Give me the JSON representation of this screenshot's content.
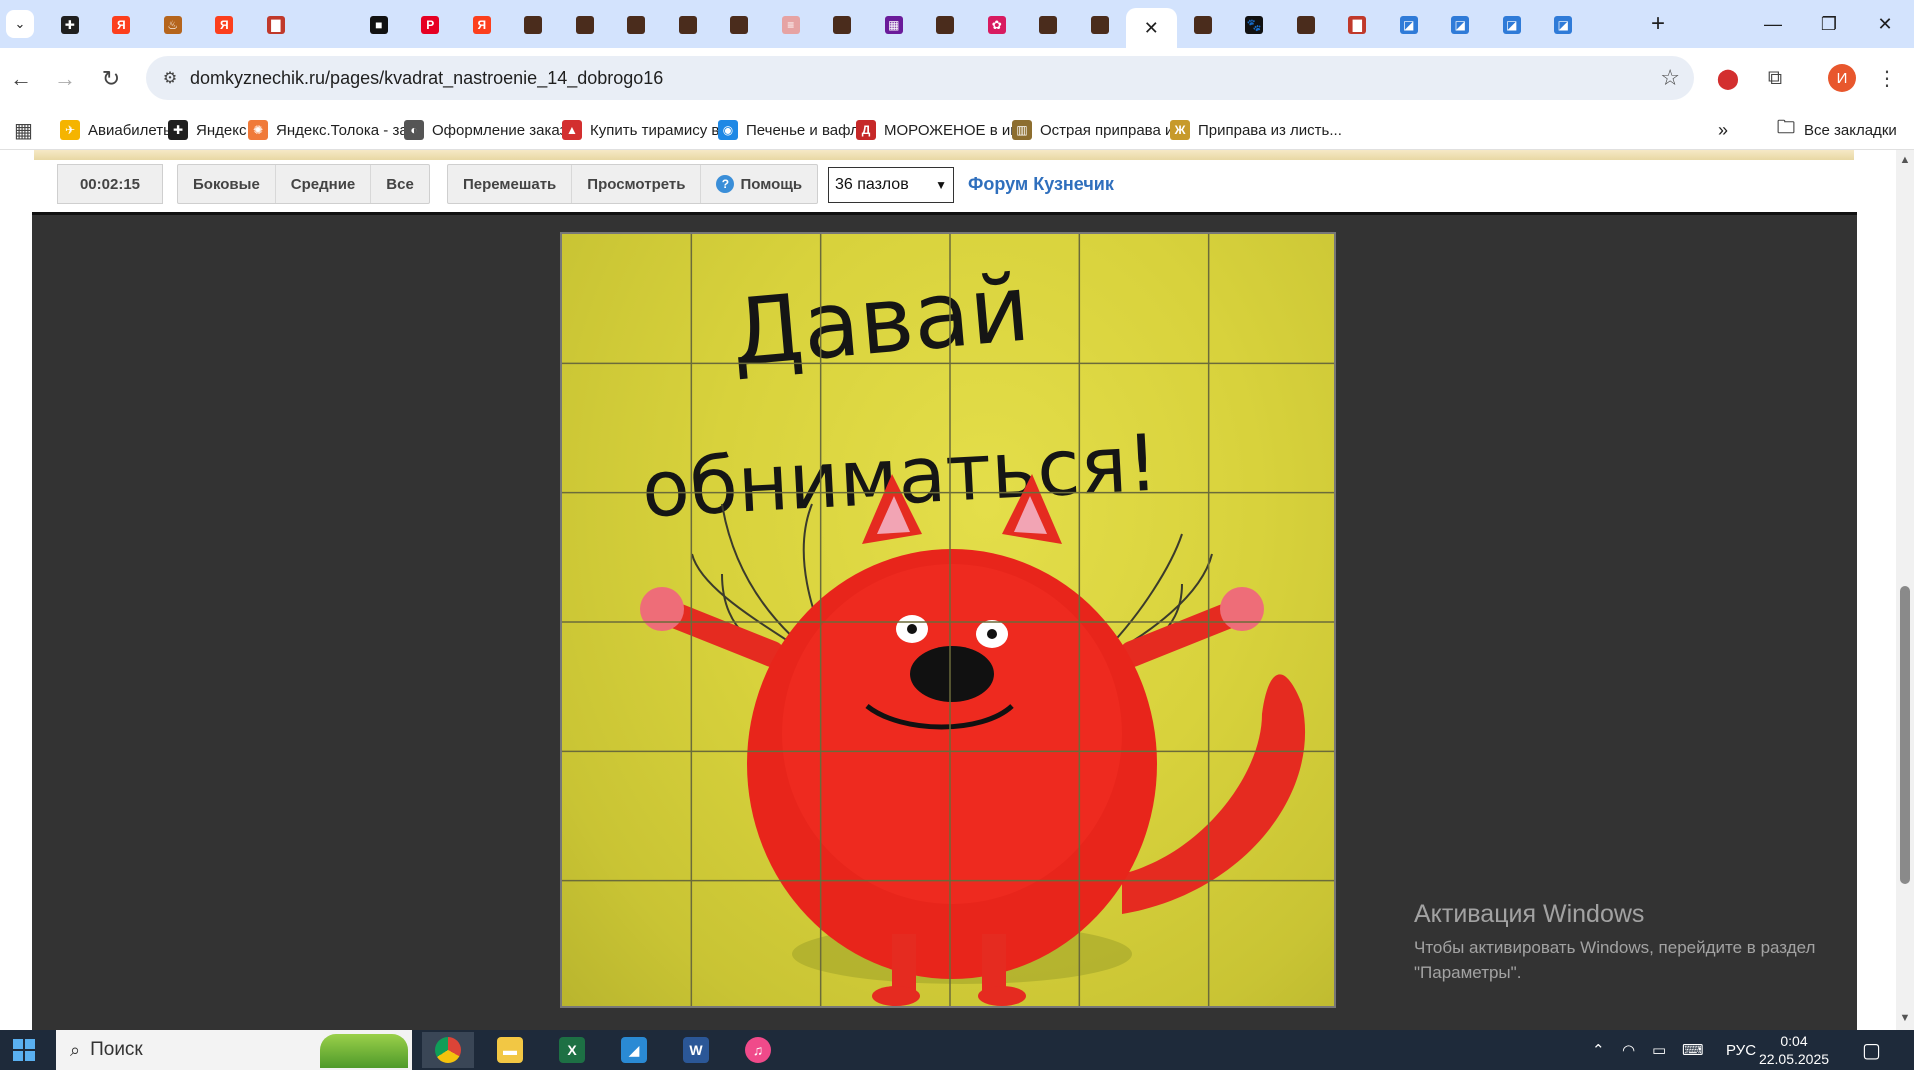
{
  "browser": {
    "tabs": [
      {
        "icon": "plus-icon",
        "color": "#1f1f1f",
        "glyph": "✚"
      },
      {
        "icon": "yandex-icon",
        "color": "#fc3f1d",
        "glyph": "Я"
      },
      {
        "icon": "bowl-icon",
        "color": "#b5651d",
        "glyph": "♨"
      },
      {
        "icon": "yandex-icon",
        "color": "#fc3f1d",
        "glyph": "Я"
      },
      {
        "icon": "red-card-icon",
        "color": "#c0392b",
        "glyph": "▇"
      },
      {
        "icon": "blank-icon",
        "color": "#d3e3fd",
        "glyph": ""
      },
      {
        "icon": "dark-square-icon",
        "color": "#111111",
        "glyph": "■"
      },
      {
        "icon": "pinterest-icon",
        "color": "#e60023",
        "glyph": "P"
      },
      {
        "icon": "yandex-icon",
        "color": "#fc3f1d",
        "glyph": "Я"
      },
      {
        "icon": "brown-square-icon",
        "color": "#4a2c1c",
        "glyph": ""
      },
      {
        "icon": "brown-square-icon",
        "color": "#4a2c1c",
        "glyph": ""
      },
      {
        "icon": "brown-square-icon",
        "color": "#4a2c1c",
        "glyph": ""
      },
      {
        "icon": "brown-square-icon",
        "color": "#4a2c1c",
        "glyph": ""
      },
      {
        "icon": "brown-square-icon",
        "color": "#4a2c1c",
        "glyph": ""
      },
      {
        "icon": "recipe-icon",
        "color": "#e6a3a3",
        "glyph": "≡"
      },
      {
        "icon": "brown-square-icon",
        "color": "#4a2c1c",
        "glyph": ""
      },
      {
        "icon": "purple-grid-icon",
        "color": "#6a1b9a",
        "glyph": "▦"
      },
      {
        "icon": "brown-square-icon",
        "color": "#4a2c1c",
        "glyph": ""
      },
      {
        "icon": "flower-icon",
        "color": "#d81b60",
        "glyph": "✿"
      },
      {
        "icon": "brown-square-icon",
        "color": "#4a2c1c",
        "glyph": ""
      },
      {
        "icon": "brown-square-icon",
        "color": "#4a2c1c",
        "glyph": ""
      },
      {
        "icon": "close-icon",
        "color": "#ffffff",
        "glyph": "✕",
        "active": true
      },
      {
        "icon": "brown-square-icon",
        "color": "#4a2c1c",
        "glyph": ""
      },
      {
        "icon": "paw-icon",
        "color": "#111111",
        "glyph": "🐾"
      },
      {
        "icon": "brown-square-icon",
        "color": "#4a2c1c",
        "glyph": ""
      },
      {
        "icon": "red-card-icon",
        "color": "#c0392b",
        "glyph": "▇"
      },
      {
        "icon": "blue-doc-icon",
        "color": "#2f7bd8",
        "glyph": "◪"
      },
      {
        "icon": "blue-doc-icon",
        "color": "#2f7bd8",
        "glyph": "◪"
      },
      {
        "icon": "blue-doc-icon",
        "color": "#2f7bd8",
        "glyph": "◪"
      },
      {
        "icon": "blue-doc-icon",
        "color": "#2f7bd8",
        "glyph": "◪"
      }
    ],
    "url": "domkyznechik.ru/pages/kvadrat_nastroenie_14_dobrogo16",
    "profile_initial": "И",
    "bookmarks": [
      {
        "label": "Авиабилеты",
        "icon": "plane-icon",
        "color": "#f5b400",
        "glyph": "✈"
      },
      {
        "label": "Яндекс",
        "icon": "yandex-plus-icon",
        "color": "#1f1f1f",
        "glyph": "✚"
      },
      {
        "label": "Яндекс.Толока - за...",
        "icon": "toloka-icon",
        "color": "#f07a3a",
        "glyph": "✺"
      },
      {
        "label": "Оформление заказ...",
        "icon": "globe-icon",
        "color": "#555555",
        "glyph": "◐"
      },
      {
        "label": "Купить тирамису в...",
        "icon": "cake-icon",
        "color": "#d32f2f",
        "glyph": "▲"
      },
      {
        "label": "Печенье и вафли",
        "icon": "basket-icon",
        "color": "#1e88e5",
        "glyph": "◉"
      },
      {
        "label": "МОРОЖЕНОЕ в ин...",
        "icon": "d-icon",
        "color": "#c62828",
        "glyph": "Д"
      },
      {
        "label": "Острая приправа и...",
        "icon": "spice-icon",
        "color": "#8d6e2f",
        "glyph": "▥"
      },
      {
        "label": "Приправа из листь...",
        "icon": "leaf-icon",
        "color": "#c79a2b",
        "glyph": "Ж"
      }
    ],
    "all_bookmarks": "Все закладки"
  },
  "puzzle_page": {
    "timer": "00:02:15",
    "filter_buttons": [
      "Боковые",
      "Средние",
      "Все"
    ],
    "action_buttons": [
      "Перемешать",
      "Просмотреть",
      "Помощь"
    ],
    "pieces_select": "36 пазлов",
    "forum_link": "Форум Кузнечик",
    "image_text_line1": "Давай",
    "image_text_line2": "обниматься!",
    "grid": {
      "rows": 6,
      "cols": 6
    }
  },
  "watermark": {
    "title": "Активация Windows",
    "text": "Чтобы активировать Windows, перейдите в раздел \"Параметры\"."
  },
  "taskbar": {
    "search_placeholder": "Поиск",
    "language": "РУС",
    "time": "0:04",
    "date": "22.05.2025"
  }
}
